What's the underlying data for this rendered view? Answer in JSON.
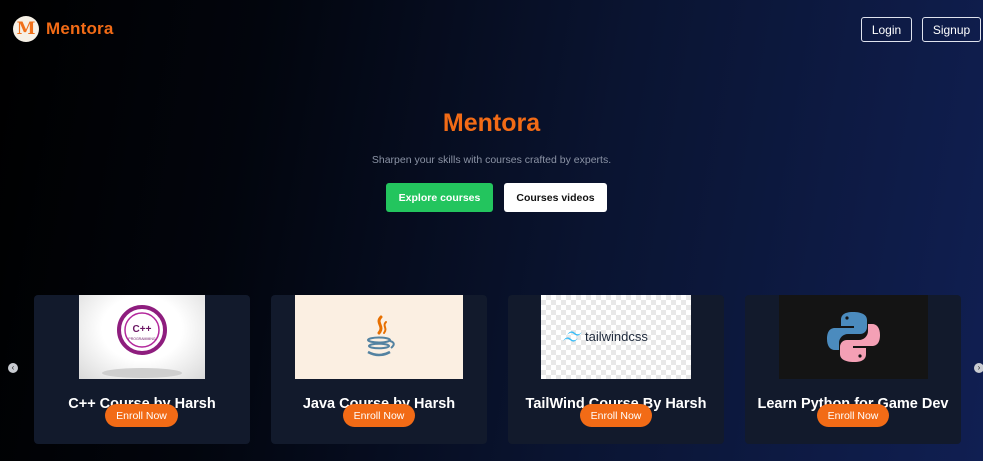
{
  "header": {
    "logo_letter": "M",
    "logo_text": "Mentora",
    "login_label": "Login",
    "signup_label": "Signup"
  },
  "hero": {
    "title": "Mentora",
    "subtitle": "Sharpen your skills with courses crafted by experts.",
    "explore_label": "Explore courses",
    "videos_label": "Courses videos"
  },
  "courses": [
    {
      "title": "C++ Course by Harsh",
      "enroll_label": "Enroll Now",
      "image_icon": "cpp-logo-icon",
      "image_text": "C++",
      "image_subtext": "PROGRAMMING"
    },
    {
      "title": "Java Course by Harsh",
      "enroll_label": "Enroll Now",
      "image_icon": "java-logo-icon"
    },
    {
      "title": "TailWind Course By Harsh",
      "enroll_label": "Enroll Now",
      "image_icon": "tailwind-logo-icon",
      "image_text": "tailwindcss"
    },
    {
      "title": "Learn Python for Game Dev",
      "enroll_label": "Enroll Now",
      "image_icon": "python-logo-icon"
    }
  ],
  "carousel": {
    "prev_icon": "chevron-left-icon",
    "next_icon": "chevron-right-icon"
  },
  "colors": {
    "brand_orange": "#f26b16",
    "explore_green": "#23c55e",
    "card_bg": "#121a2c",
    "background_start": "#000000",
    "background_end": "#101f52"
  }
}
